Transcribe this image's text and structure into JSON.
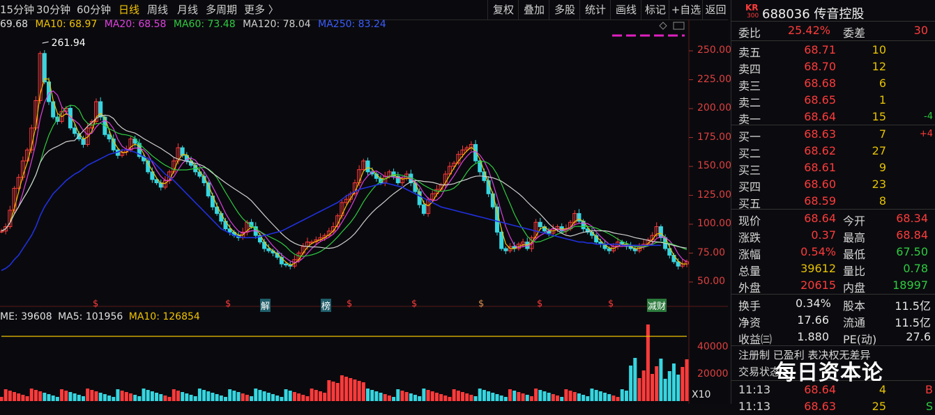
{
  "toolbar": {
    "periods": [
      "15分钟",
      "30分钟",
      "60分钟",
      "日线",
      "周线",
      "月线",
      "多周期",
      "更多 〉"
    ],
    "active_period": "日线",
    "buttons": [
      "复权",
      "叠加",
      "多股",
      "统计",
      "画线",
      "标记",
      "+自选",
      "返回"
    ]
  },
  "ma": {
    "ma5": "69.68",
    "ma10": "MA10: 68.97",
    "ma20": "MA20: 68.58",
    "ma60": "MA60: 73.48",
    "ma120": "MA120: 78.04",
    "ma250": "MA250: 83.24"
  },
  "chart_data": {
    "type": "line",
    "title": "",
    "peak_label": "261.94",
    "ylim": [
      40,
      275
    ],
    "yticks": [
      "250.00",
      "225.00",
      "200.00",
      "175.00",
      "150.00",
      "125.00",
      "100.00",
      "75.00",
      "50.00"
    ],
    "close": [
      96,
      100,
      115,
      135,
      145,
      160,
      170,
      190,
      215,
      258,
      232,
      214,
      200,
      196,
      205,
      208,
      190,
      185,
      180,
      175,
      190,
      196,
      214,
      200,
      184,
      180,
      170,
      165,
      168,
      170,
      180,
      176,
      164,
      160,
      150,
      143,
      140,
      136,
      142,
      150,
      160,
      172,
      165,
      160,
      156,
      150,
      146,
      140,
      128,
      118,
      112,
      105,
      98,
      95,
      92,
      90,
      95,
      104,
      100,
      92,
      86,
      80,
      78,
      76,
      72,
      66,
      65,
      64,
      70,
      76,
      82,
      86,
      86,
      88,
      90,
      92,
      96,
      100,
      110,
      122,
      125,
      130,
      140,
      152,
      160,
      150,
      148,
      144,
      140,
      146,
      150,
      146,
      140,
      144,
      148,
      140,
      132,
      120,
      112,
      125,
      130,
      134,
      138,
      148,
      155,
      158,
      166,
      170,
      172,
      175,
      160,
      150,
      142,
      130,
      118,
      95,
      80,
      78,
      82,
      80,
      84,
      86,
      80,
      90,
      104,
      100,
      96,
      94,
      98,
      100,
      96,
      98,
      104,
      112,
      105,
      98,
      95,
      92,
      86,
      84,
      80,
      78,
      82,
      86,
      84,
      82,
      80,
      78,
      82,
      84,
      88,
      92,
      100,
      90,
      80,
      74,
      68,
      64,
      66,
      68
    ],
    "ma250": [
      60,
      62,
      65,
      70,
      74,
      80,
      86,
      92,
      100,
      110,
      118,
      124,
      130,
      134,
      138,
      142,
      145,
      148,
      150,
      153,
      156,
      158,
      160,
      162,
      164,
      166,
      167,
      168,
      170,
      170,
      169,
      168,
      166,
      164,
      162,
      160,
      156,
      152,
      148,
      145,
      142,
      138,
      134,
      130,
      126,
      122,
      118,
      114,
      110,
      106,
      102,
      98,
      96,
      94,
      92,
      91,
      90,
      90,
      90,
      90,
      91,
      92,
      93,
      94,
      95,
      96,
      98,
      100,
      102,
      104,
      106,
      108,
      110,
      112,
      114,
      116,
      118,
      120,
      122,
      125,
      128,
      130,
      132,
      134,
      135,
      136,
      137,
      138,
      139,
      140,
      139,
      138,
      137,
      136,
      134,
      132,
      130,
      128,
      126,
      124,
      122,
      120,
      118,
      117,
      116,
      115,
      114,
      113,
      112,
      111,
      110,
      109,
      108,
      107,
      106,
      105,
      104,
      103,
      102,
      101,
      100,
      99,
      98,
      97,
      96,
      95,
      94,
      93,
      92,
      91,
      90,
      89,
      88,
      87,
      86,
      86,
      85,
      85,
      84,
      84,
      84,
      84,
      84,
      84,
      83,
      83,
      83,
      83,
      83,
      83,
      83,
      83,
      83,
      83
    ],
    "volume_labels": [
      "40000",
      "20000",
      "X10"
    ]
  },
  "markers": [
    {
      "sym": "$",
      "color": "#ff3b3b"
    },
    {
      "sym": "$",
      "color": "#ff3b3b"
    },
    {
      "sym": "解",
      "color": "#3cc"
    },
    {
      "sym": "榜",
      "color": "#e09050"
    },
    {
      "sym": "$",
      "color": "#ff3b3b"
    },
    {
      "sym": "$",
      "color": "#ff3b3b"
    },
    {
      "sym": "$",
      "color": "#e09050"
    },
    {
      "sym": "$",
      "color": "#ff3b3b"
    },
    {
      "sym": "$",
      "color": "#ff3b3b"
    },
    {
      "sym": "减财",
      "color": "#ffffff"
    }
  ],
  "volume": {
    "me": "ME: 39608",
    "ma5": "MA5: 101956",
    "ma10": "MA10: 126854"
  },
  "stock": {
    "badge_top": "KR",
    "badge_bottom": "300",
    "code_name": "688036 传音控股"
  },
  "weibi": {
    "label": "委比",
    "value": "25.42%",
    "label2": "委差",
    "value2": "30"
  },
  "asks": [
    {
      "label": "卖五",
      "price": "68.71",
      "vol": "10",
      "chg": ""
    },
    {
      "label": "卖四",
      "price": "68.70",
      "vol": "12",
      "chg": ""
    },
    {
      "label": "卖三",
      "price": "68.68",
      "vol": "6",
      "chg": ""
    },
    {
      "label": "卖二",
      "price": "68.65",
      "vol": "1",
      "chg": ""
    },
    {
      "label": "卖一",
      "price": "68.64",
      "vol": "15",
      "chg": "-4"
    }
  ],
  "bids": [
    {
      "label": "买一",
      "price": "68.63",
      "vol": "7",
      "chg": "+4"
    },
    {
      "label": "买二",
      "price": "68.62",
      "vol": "27",
      "chg": ""
    },
    {
      "label": "买三",
      "price": "68.61",
      "vol": "9",
      "chg": ""
    },
    {
      "label": "买四",
      "price": "68.60",
      "vol": "23",
      "chg": ""
    },
    {
      "label": "买五",
      "price": "68.59",
      "vol": "8",
      "chg": ""
    }
  ],
  "stats": {
    "xj_l": "现价",
    "xj_v": "68.64",
    "jk_l": "今开",
    "jk_v": "68.34",
    "zd_l": "涨跌",
    "zd_v": "0.37",
    "zg_l": "最高",
    "zg_v": "68.84",
    "zf_l": "涨幅",
    "zf_v": "0.54%",
    "zdi_l": "最低",
    "zdi_v": "67.50",
    "zl_l": "总量",
    "zl_v": "39612",
    "lb_l": "量比",
    "lb_v": "0.78",
    "wp_l": "外盘",
    "wp_v": "20615",
    "np_l": "内盘",
    "np_v": "18997"
  },
  "fin": {
    "hs_l": "换手",
    "hs_v": "0.34%",
    "gb_l": "股本",
    "gb_v": "11.5亿",
    "jz_l": "净资",
    "jz_v": "17.66",
    "lt_l": "流通",
    "lt_v": "11.5亿",
    "sy_l": "收益㈢",
    "sy_v": "1.880",
    "pe_l": "PE(动)",
    "pe_v": "27.6"
  },
  "note": "注册制 已盈利 表决权无差异",
  "status": "交易状态",
  "ticks": [
    {
      "time": "11:13",
      "price": "68.64",
      "vol": "4",
      "side": "B"
    },
    {
      "time": "11:13",
      "price": "68.63",
      "vol": "25",
      "side": "S"
    }
  ],
  "watermark": "每日资本论"
}
